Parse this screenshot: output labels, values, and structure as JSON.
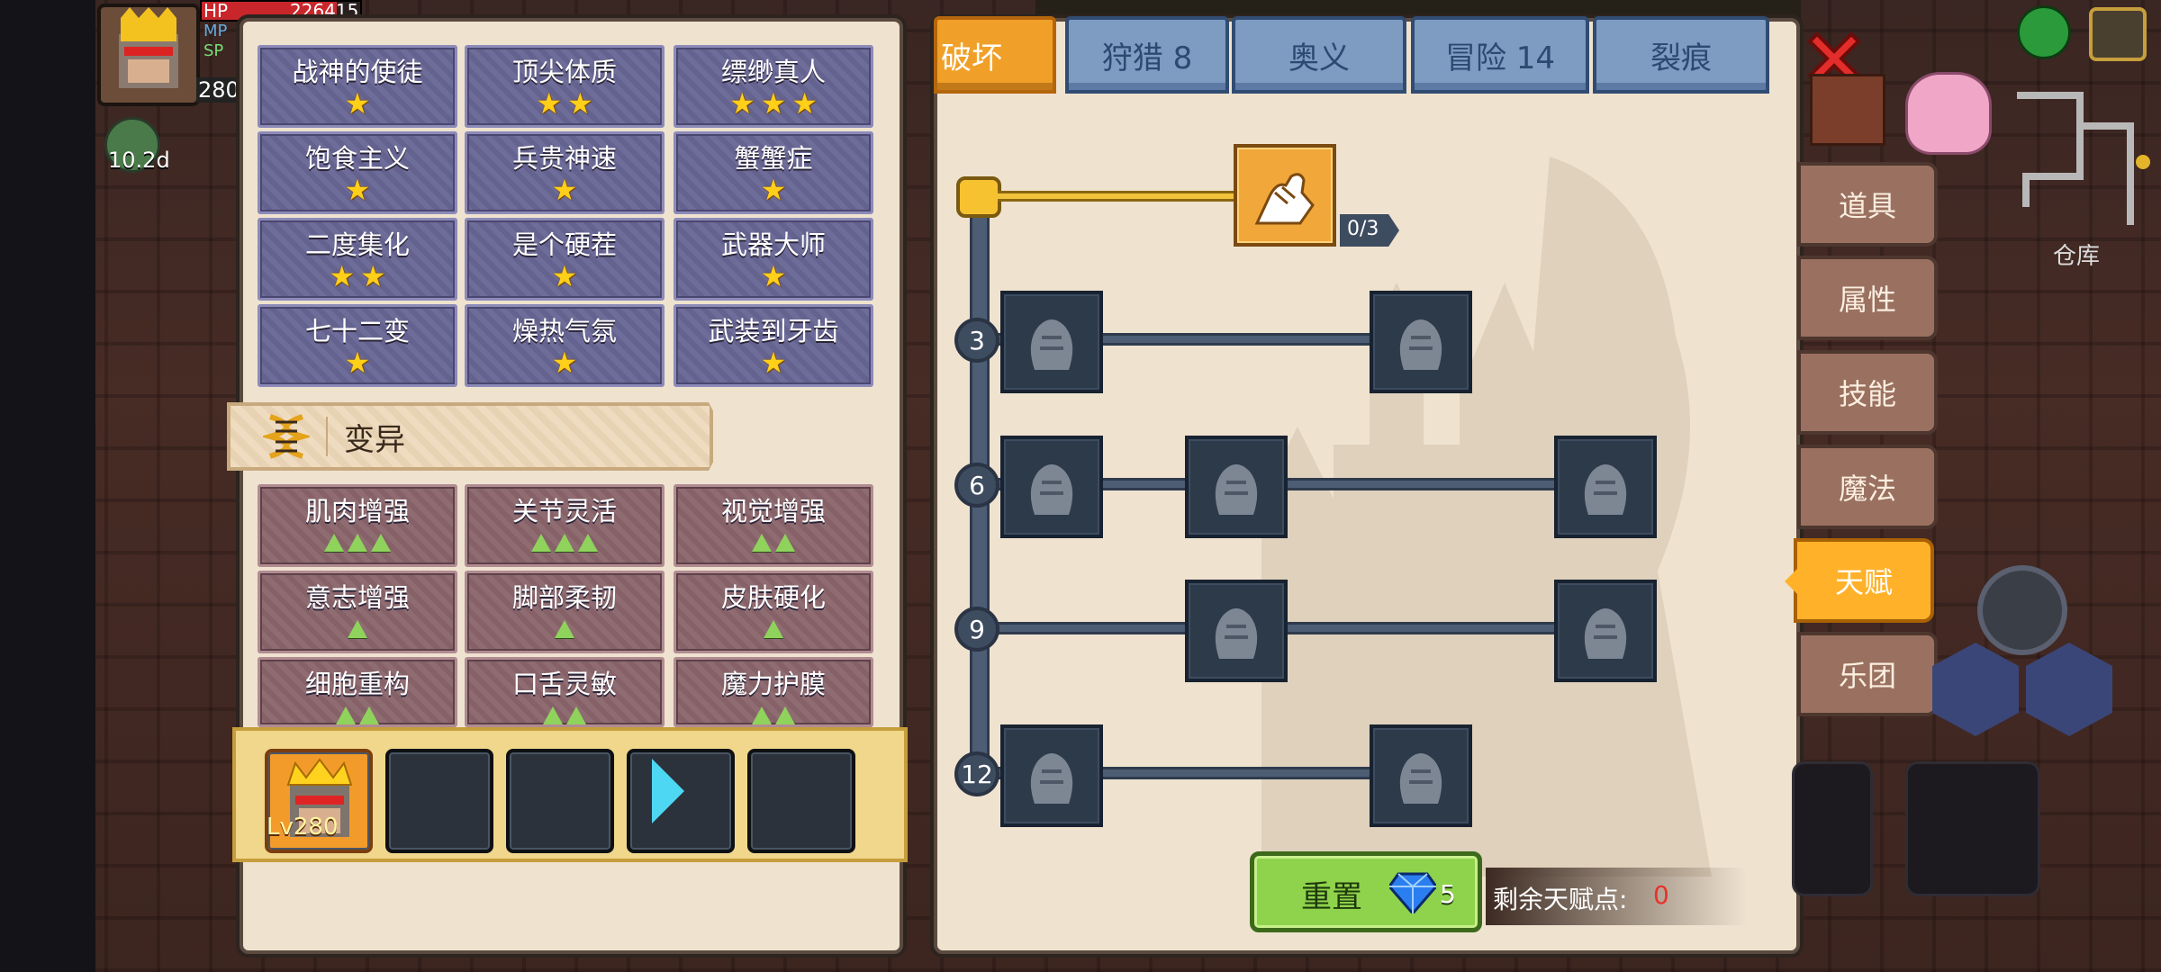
{
  "hud": {
    "hp_label": "HP",
    "hp_value": "226415",
    "mp_label": "MP",
    "sp_label": "SP",
    "level": "280",
    "buff_timer": "10.2d"
  },
  "traits": [
    {
      "name": "战神的使徒",
      "stars": 1
    },
    {
      "name": "顶尖体质",
      "stars": 2
    },
    {
      "name": "缥缈真人",
      "stars": 3
    },
    {
      "name": "饱食主义",
      "stars": 1
    },
    {
      "name": "兵贵神速",
      "stars": 1
    },
    {
      "name": "蟹蟹症",
      "stars": 1
    },
    {
      "name": "二度集化",
      "stars": 2
    },
    {
      "name": "是个硬茬",
      "stars": 1
    },
    {
      "name": "武器大师",
      "stars": 1
    },
    {
      "name": "七十二变",
      "stars": 1
    },
    {
      "name": "燥热气氛",
      "stars": 1
    },
    {
      "name": "武装到牙齿",
      "stars": 1
    }
  ],
  "mutation_section": {
    "title": "变异",
    "icon": "dna-icon"
  },
  "mutations": [
    {
      "name": "肌肉增强",
      "level": 3
    },
    {
      "name": "关节灵活",
      "level": 3
    },
    {
      "name": "视觉增强",
      "level": 2
    },
    {
      "name": "意志增强",
      "level": 1
    },
    {
      "name": "脚部柔韧",
      "level": 1
    },
    {
      "name": "皮肤硬化",
      "level": 1
    },
    {
      "name": "细胞重构",
      "level": 2
    },
    {
      "name": "口舌灵敏",
      "level": 2
    },
    {
      "name": "魔力护膜",
      "level": 2
    }
  ],
  "party": {
    "hero_level": "Lv280"
  },
  "tabs": {
    "active": "破坏",
    "hunt": "狩猎 8",
    "secret": "奥义",
    "adventure": "冒险 14",
    "rift": "裂痕"
  },
  "side_tabs": [
    "道具",
    "属性",
    "技能",
    "魔法",
    "天赋",
    "乐团"
  ],
  "side_active": "天赋",
  "talent_tree": {
    "root_progress": "0/3",
    "levels": [
      "3",
      "6",
      "9",
      "12"
    ]
  },
  "reset": {
    "label": "重置",
    "cost": "5"
  },
  "remaining": {
    "label": "剩余天赋点:",
    "value": "0"
  },
  "map": {
    "label": "仓库"
  },
  "colors": {
    "accent": "#f0a028",
    "tab": "#7e9bc2",
    "panel": "#efe3d0",
    "remaining_value": "#e8322a"
  }
}
